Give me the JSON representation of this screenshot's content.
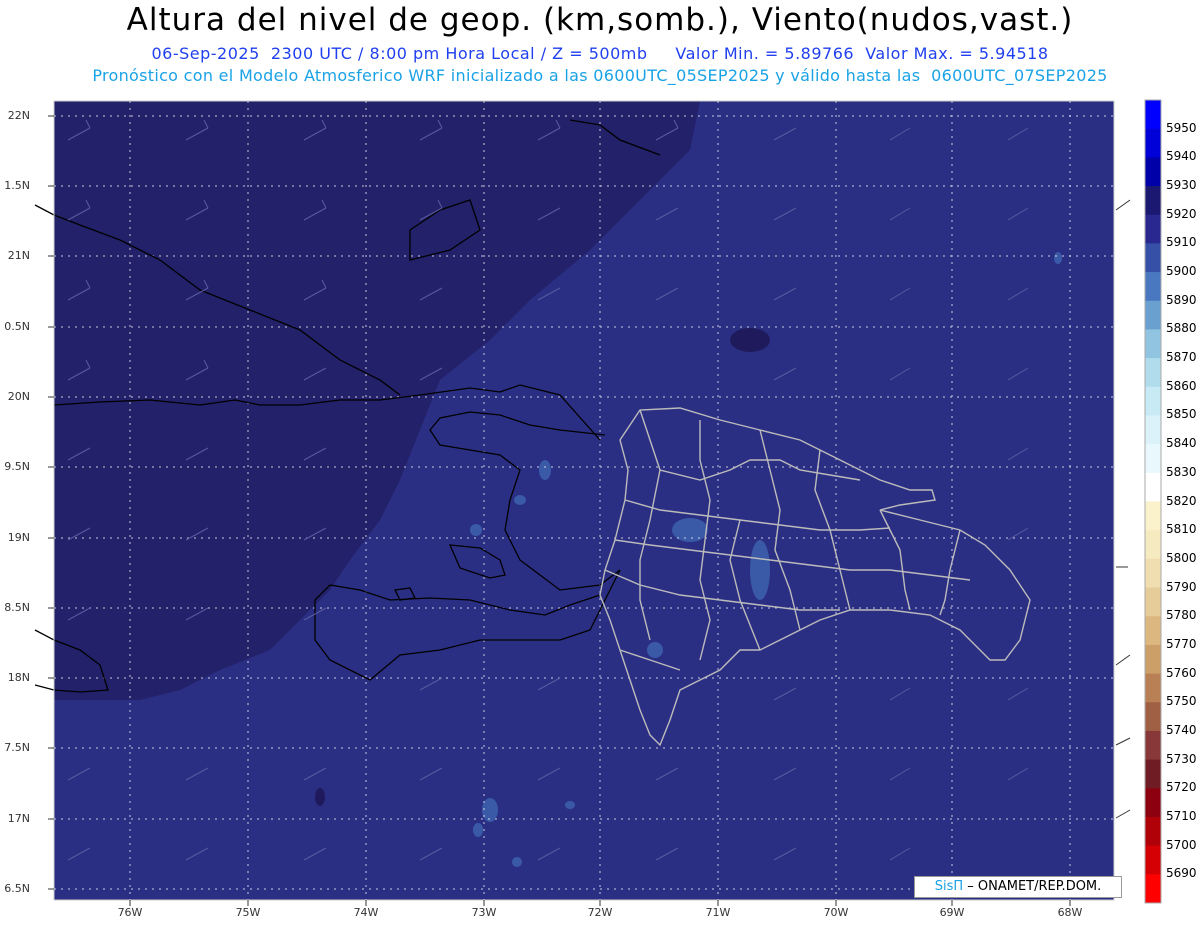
{
  "header": {
    "title": "Altura del nivel de geop. (km,somb.), Viento(nudos,vast.)",
    "subtitle": "06-Sep-2025  2300 UTC / 8:00 pm Hora Local / Z = 500mb     Valor Min. = 5.89766  Valor Max. = 5.94518",
    "info": "Pronóstico con el Modelo Atmosferico WRF inicializado a las 0600UTC_05SEP2025 y válido hasta las  0600UTC_07SEP2025"
  },
  "axes": {
    "lat_labels": [
      "22N",
      "1.5N",
      "21N",
      "0.5N",
      "20N",
      "9.5N",
      "19N",
      "8.5N",
      "18N",
      "7.5N",
      "17N",
      "6.5N"
    ],
    "lon_labels": [
      "76W",
      "75W",
      "74W",
      "73W",
      "72W",
      "71W",
      "70W",
      "69W",
      "68W"
    ]
  },
  "colorbar": {
    "labels": [
      "5950",
      "5940",
      "5930",
      "5920",
      "5910",
      "5900",
      "5890",
      "5880",
      "5870",
      "5860",
      "5850",
      "5840",
      "5830",
      "5820",
      "5810",
      "5800",
      "5790",
      "5780",
      "5770",
      "5760",
      "5750",
      "5740",
      "5730",
      "5720",
      "5710",
      "5700",
      "5690"
    ],
    "colors": [
      "#0000ff",
      "#0000d8",
      "#0000a8",
      "#1a1870",
      "#282890",
      "#3650a8",
      "#4a78c0",
      "#6aa0d0",
      "#90c4e0",
      "#b0dcec",
      "#c8eaf4",
      "#dcf2fa",
      "#e8f8fc",
      "#ffffff",
      "#fbf2cc",
      "#f6eac0",
      "#f0deb0",
      "#e6cc98",
      "#dcb880",
      "#cc9e68",
      "#b88054",
      "#a06044",
      "#883838",
      "#701c24",
      "#8c0010",
      "#b00008",
      "#d40004",
      "#ff0000"
    ]
  },
  "colors": {
    "field_dark": "#23216a",
    "field_mid": "#2b2f84",
    "field_light": "#3a5aa8",
    "coast_dr": "#bbbbbb",
    "coast_other": "#000000"
  },
  "credit": {
    "brand": "SisΠ",
    "text": "– ONAMET/REP.DOM."
  }
}
